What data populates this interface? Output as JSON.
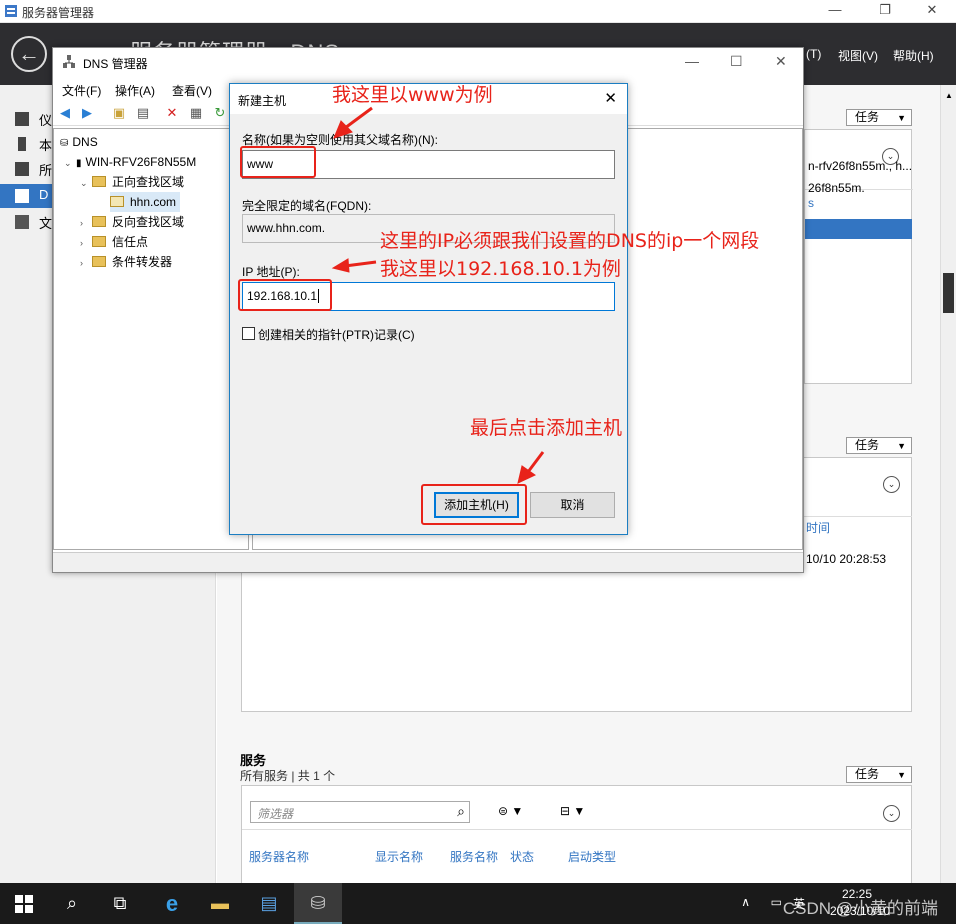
{
  "server_manager": {
    "title": "服务器管理器",
    "header_partial": "服务器管理器 · DNS",
    "menus": [
      "(T)",
      "视图(V)",
      "帮助(H)"
    ],
    "tools_menu": "(T)",
    "left_nav": [
      {
        "label": "仪"
      },
      {
        "label": "本"
      },
      {
        "label": "所"
      },
      {
        "label": "D"
      },
      {
        "label": "文"
      }
    ],
    "tasks_label": "任务",
    "servers_panel": {
      "row1": "n-rfv26f8n55m., h...",
      "row2": "26f8n55m.",
      "link": "s"
    },
    "events_panel": {
      "time_header": "时间",
      "time_value": "10/10 20:28:53"
    },
    "services": {
      "title": "服务",
      "subtitle": "所有服务 | 共 1 个",
      "filter_placeholder": "筛选器",
      "columns": [
        "服务器名称",
        "显示名称",
        "服务名称",
        "状态",
        "启动类型"
      ]
    }
  },
  "dns_manager": {
    "title": "DNS 管理器",
    "menus": [
      "文件(F)",
      "操作(A)",
      "查看(V)"
    ],
    "tree": {
      "root": "DNS",
      "server": "WIN-RFV26F8N55M",
      "forward_zones": "正向查找区域",
      "zone": "hhn.com",
      "reverse_zones": "反向查找区域",
      "trust_points": "信任点",
      "conditional_forwarders": "条件转发器"
    }
  },
  "new_host_dialog": {
    "title": "新建主机",
    "name_label": "名称(如果为空则使用其父域名称)(N):",
    "name_value": "www",
    "fqdn_label": "完全限定的域名(FQDN):",
    "fqdn_value": "www.hhn.com.",
    "ip_label": "IP 地址(P):",
    "ip_value": "192.168.10.1",
    "ptr_label": "创建相关的指针(PTR)记录(C)",
    "ptr_checked": false,
    "add_button": "添加主机(H)",
    "cancel_button": "取消"
  },
  "annotations": {
    "note_name": "我这里以www为例",
    "note_ip_1": "这里的IP必须跟我们设置的DNS的ip一个网段",
    "note_ip_2": "我这里以192.168.10.1为例",
    "note_add": "最后点击添加主机",
    "color": "#e8231a"
  },
  "taskbar": {
    "tray_lang": "英",
    "time": "22:25",
    "date": "2023/10/10",
    "watermark": "CSDN @小黄的前端"
  }
}
